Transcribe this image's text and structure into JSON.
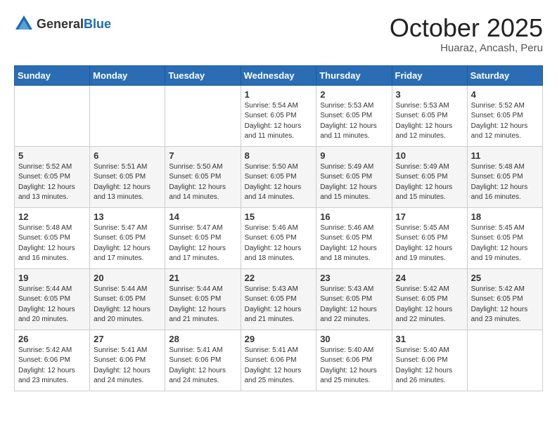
{
  "header": {
    "logo_general": "General",
    "logo_blue": "Blue",
    "month": "October 2025",
    "location": "Huaraz, Ancash, Peru"
  },
  "weekdays": [
    "Sunday",
    "Monday",
    "Tuesday",
    "Wednesday",
    "Thursday",
    "Friday",
    "Saturday"
  ],
  "weeks": [
    [
      {
        "day": "",
        "info": ""
      },
      {
        "day": "",
        "info": ""
      },
      {
        "day": "",
        "info": ""
      },
      {
        "day": "1",
        "info": "Sunrise: 5:54 AM\nSunset: 6:05 PM\nDaylight: 12 hours\nand 11 minutes."
      },
      {
        "day": "2",
        "info": "Sunrise: 5:53 AM\nSunset: 6:05 PM\nDaylight: 12 hours\nand 11 minutes."
      },
      {
        "day": "3",
        "info": "Sunrise: 5:53 AM\nSunset: 6:05 PM\nDaylight: 12 hours\nand 12 minutes."
      },
      {
        "day": "4",
        "info": "Sunrise: 5:52 AM\nSunset: 6:05 PM\nDaylight: 12 hours\nand 12 minutes."
      }
    ],
    [
      {
        "day": "5",
        "info": "Sunrise: 5:52 AM\nSunset: 6:05 PM\nDaylight: 12 hours\nand 13 minutes."
      },
      {
        "day": "6",
        "info": "Sunrise: 5:51 AM\nSunset: 6:05 PM\nDaylight: 12 hours\nand 13 minutes."
      },
      {
        "day": "7",
        "info": "Sunrise: 5:50 AM\nSunset: 6:05 PM\nDaylight: 12 hours\nand 14 minutes."
      },
      {
        "day": "8",
        "info": "Sunrise: 5:50 AM\nSunset: 6:05 PM\nDaylight: 12 hours\nand 14 minutes."
      },
      {
        "day": "9",
        "info": "Sunrise: 5:49 AM\nSunset: 6:05 PM\nDaylight: 12 hours\nand 15 minutes."
      },
      {
        "day": "10",
        "info": "Sunrise: 5:49 AM\nSunset: 6:05 PM\nDaylight: 12 hours\nand 15 minutes."
      },
      {
        "day": "11",
        "info": "Sunrise: 5:48 AM\nSunset: 6:05 PM\nDaylight: 12 hours\nand 16 minutes."
      }
    ],
    [
      {
        "day": "12",
        "info": "Sunrise: 5:48 AM\nSunset: 6:05 PM\nDaylight: 12 hours\nand 16 minutes."
      },
      {
        "day": "13",
        "info": "Sunrise: 5:47 AM\nSunset: 6:05 PM\nDaylight: 12 hours\nand 17 minutes."
      },
      {
        "day": "14",
        "info": "Sunrise: 5:47 AM\nSunset: 6:05 PM\nDaylight: 12 hours\nand 17 minutes."
      },
      {
        "day": "15",
        "info": "Sunrise: 5:46 AM\nSunset: 6:05 PM\nDaylight: 12 hours\nand 18 minutes."
      },
      {
        "day": "16",
        "info": "Sunrise: 5:46 AM\nSunset: 6:05 PM\nDaylight: 12 hours\nand 18 minutes."
      },
      {
        "day": "17",
        "info": "Sunrise: 5:45 AM\nSunset: 6:05 PM\nDaylight: 12 hours\nand 19 minutes."
      },
      {
        "day": "18",
        "info": "Sunrise: 5:45 AM\nSunset: 6:05 PM\nDaylight: 12 hours\nand 19 minutes."
      }
    ],
    [
      {
        "day": "19",
        "info": "Sunrise: 5:44 AM\nSunset: 6:05 PM\nDaylight: 12 hours\nand 20 minutes."
      },
      {
        "day": "20",
        "info": "Sunrise: 5:44 AM\nSunset: 6:05 PM\nDaylight: 12 hours\nand 20 minutes."
      },
      {
        "day": "21",
        "info": "Sunrise: 5:44 AM\nSunset: 6:05 PM\nDaylight: 12 hours\nand 21 minutes."
      },
      {
        "day": "22",
        "info": "Sunrise: 5:43 AM\nSunset: 6:05 PM\nDaylight: 12 hours\nand 21 minutes."
      },
      {
        "day": "23",
        "info": "Sunrise: 5:43 AM\nSunset: 6:05 PM\nDaylight: 12 hours\nand 22 minutes."
      },
      {
        "day": "24",
        "info": "Sunrise: 5:42 AM\nSunset: 6:05 PM\nDaylight: 12 hours\nand 22 minutes."
      },
      {
        "day": "25",
        "info": "Sunrise: 5:42 AM\nSunset: 6:05 PM\nDaylight: 12 hours\nand 23 minutes."
      }
    ],
    [
      {
        "day": "26",
        "info": "Sunrise: 5:42 AM\nSunset: 6:06 PM\nDaylight: 12 hours\nand 23 minutes."
      },
      {
        "day": "27",
        "info": "Sunrise: 5:41 AM\nSunset: 6:06 PM\nDaylight: 12 hours\nand 24 minutes."
      },
      {
        "day": "28",
        "info": "Sunrise: 5:41 AM\nSunset: 6:06 PM\nDaylight: 12 hours\nand 24 minutes."
      },
      {
        "day": "29",
        "info": "Sunrise: 5:41 AM\nSunset: 6:06 PM\nDaylight: 12 hours\nand 25 minutes."
      },
      {
        "day": "30",
        "info": "Sunrise: 5:40 AM\nSunset: 6:06 PM\nDaylight: 12 hours\nand 25 minutes."
      },
      {
        "day": "31",
        "info": "Sunrise: 5:40 AM\nSunset: 6:06 PM\nDaylight: 12 hours\nand 26 minutes."
      },
      {
        "day": "",
        "info": ""
      }
    ]
  ]
}
